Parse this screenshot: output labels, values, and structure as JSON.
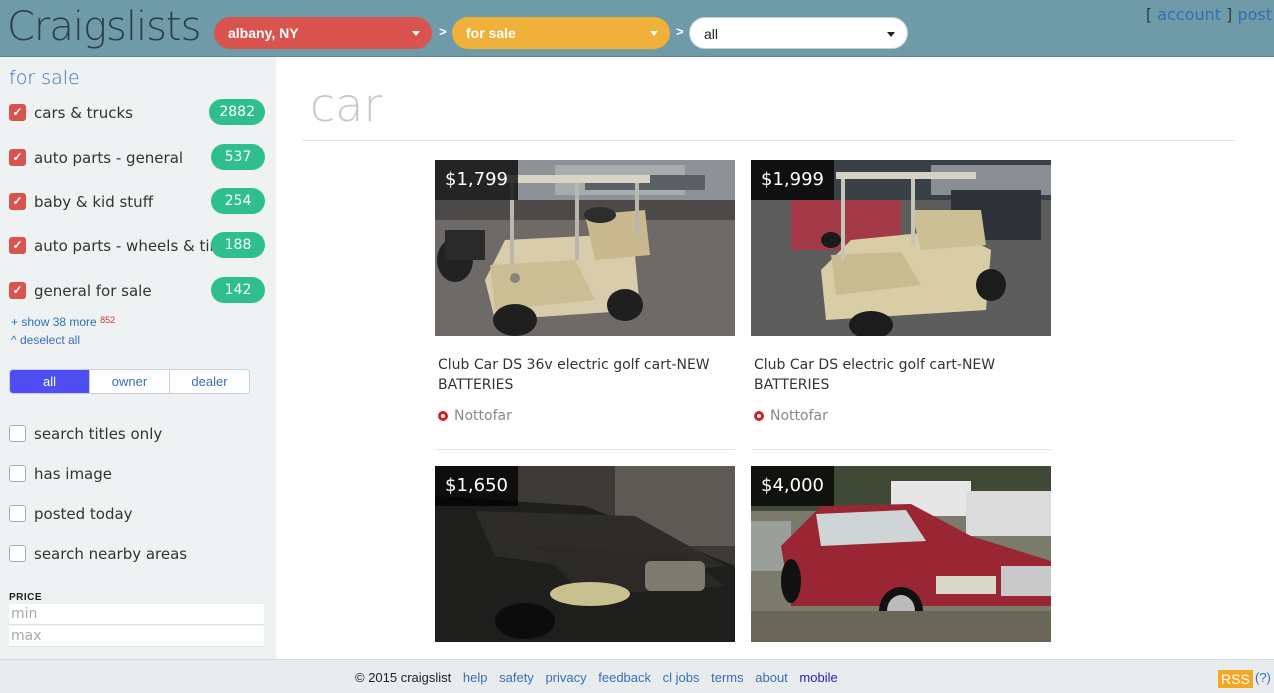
{
  "header": {
    "logo": "Craigslists",
    "area": "albany, NY",
    "category": "for sale",
    "subcategory": "all",
    "separator": ">",
    "account_open": "[",
    "account_label": "account",
    "account_close": "]",
    "post_label": "post"
  },
  "sidebar": {
    "title": "for sale",
    "categories": [
      {
        "label": "cars & trucks",
        "count": "2882"
      },
      {
        "label": "auto parts - general",
        "count": "537"
      },
      {
        "label": "baby & kid stuff",
        "count": "254"
      },
      {
        "label": "auto parts - wheels & tires",
        "count": "188"
      },
      {
        "label": "general for sale",
        "count": "142"
      }
    ],
    "show_more": "+ show 38 more",
    "show_more_count": "852",
    "deselect": "^ deselect all",
    "seller_tabs": [
      "all",
      "owner",
      "dealer"
    ],
    "options": [
      "search titles only",
      "has image",
      "posted today",
      "search nearby areas"
    ],
    "price_label": "PRICE",
    "min_placeholder": "min",
    "max_placeholder": "max"
  },
  "main": {
    "query": "car",
    "listings": [
      {
        "price": "$1,799",
        "title": "Club Car DS 36v electric golf cart-NEW BATTERIES",
        "location": "Nottofar"
      },
      {
        "price": "$1,999",
        "title": "Club Car DS electric golf cart-NEW BATTERIES",
        "location": "Nottofar"
      },
      {
        "price": "$1,650",
        "title": "",
        "location": ""
      },
      {
        "price": "$4,000",
        "title": "",
        "location": ""
      }
    ]
  },
  "footer": {
    "copyright": "© 2015 craigslist",
    "links": [
      "help",
      "safety",
      "privacy",
      "feedback",
      "cl jobs",
      "terms",
      "about"
    ],
    "mobile": "mobile",
    "rss": "RSS",
    "rss_help": "(?)"
  },
  "colors": {
    "header_bg": "#6f9aa8",
    "area_pill": "#d9534f",
    "category_pill": "#efb13a",
    "count_badge": "#2fbf8f",
    "active_tab": "#4d4ff2"
  }
}
